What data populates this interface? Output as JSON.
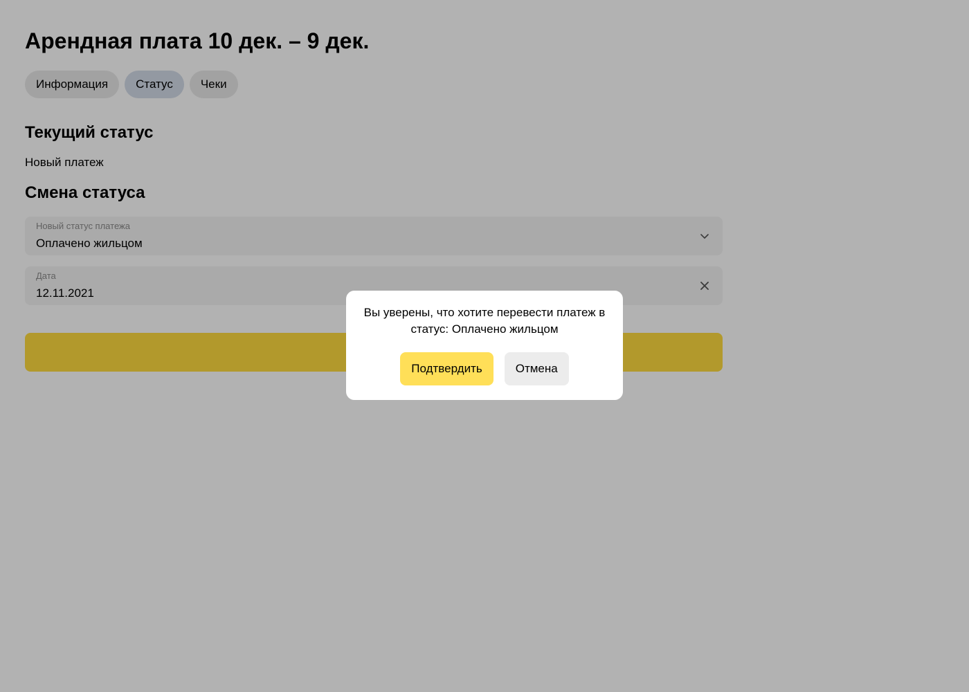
{
  "page": {
    "title": "Арендная плата 10 дек. – 9 дек."
  },
  "tabs": [
    {
      "label": "Информация",
      "active": false
    },
    {
      "label": "Статус",
      "active": true
    },
    {
      "label": "Чеки",
      "active": false
    }
  ],
  "current_status": {
    "title": "Текущий статус",
    "value": "Новый платеж"
  },
  "change_status": {
    "title": "Смена статуса",
    "status_field": {
      "label": "Новый статус платежа",
      "value": "Оплачено жильцом",
      "icon": "chevron-down-icon"
    },
    "date_field": {
      "label": "Дата",
      "value": "12.11.2021",
      "icon": "close-icon"
    },
    "submit_color": "#ffdc3f"
  },
  "modal": {
    "text": "Вы уверены, что хотите перевести платеж в статус: Оплачено жильцом",
    "confirm_label": "Подтвердить",
    "cancel_label": "Отмена",
    "confirm_color": "#ffdf58"
  }
}
